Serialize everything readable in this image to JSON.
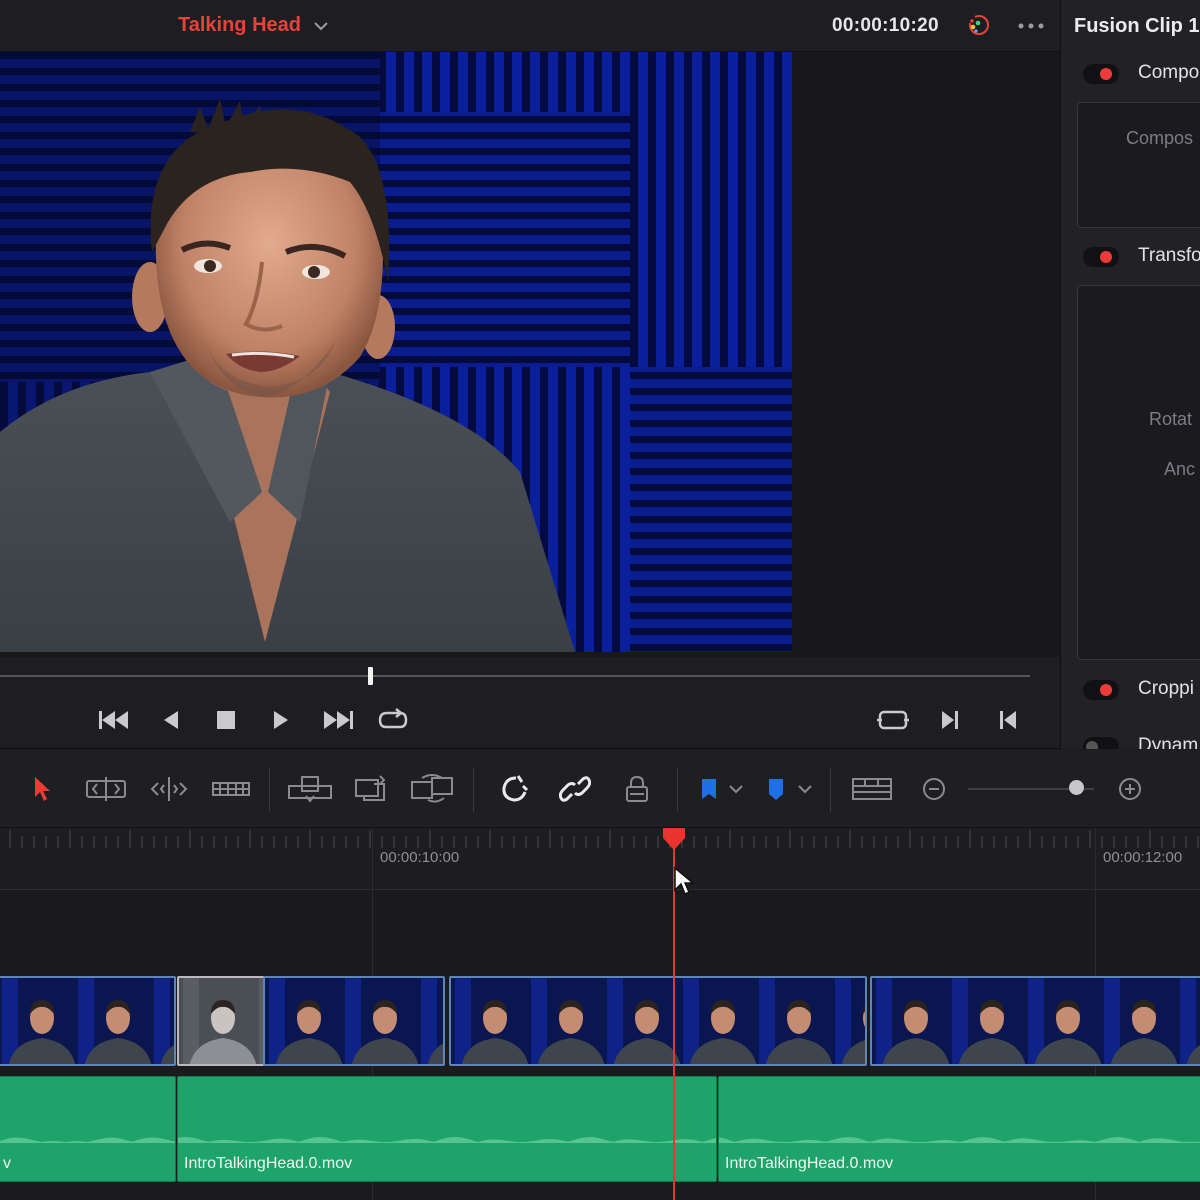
{
  "header": {
    "timeline_name": "Talking Head",
    "timecode": "00:00:10:20"
  },
  "inspector": {
    "title": "Fusion Clip 1",
    "sections": [
      {
        "label": "Compo"
      },
      {
        "label": "Transfo"
      },
      {
        "label": "Croppi"
      },
      {
        "label": "Dynam"
      }
    ],
    "fields": {
      "composite": "Compos",
      "rotation": "Rotat",
      "anchor": "Anc"
    }
  },
  "timeline": {
    "ruler_labels": [
      "00:00:10:00",
      "00:00:12:00"
    ],
    "audio_clips": [
      {
        "name": "v"
      },
      {
        "name": "IntroTalkingHead.0.mov"
      },
      {
        "name": "IntroTalkingHead.0.mov"
      }
    ]
  },
  "colors": {
    "accent_red": "#e8413a",
    "audio_green": "#1ea46a",
    "video_clip_border": "#5e86b5",
    "flag_blue": "#1f6fe6"
  },
  "icons": {
    "transport": [
      "skip-to-start-icon",
      "play-reverse-icon",
      "stop-icon",
      "play-icon",
      "skip-to-end-icon",
      "loop-icon",
      "match-frame-icon",
      "next-edit-icon",
      "previous-edit-icon"
    ],
    "toolbar": [
      "selection-arrow-icon",
      "trim-edit-icon",
      "dynamic-trim-icon",
      "blade-icon",
      "insert-clip-icon",
      "overwrite-clip-icon",
      "replace-clip-icon",
      "snapping-icon",
      "linked-selection-icon",
      "position-lock-icon",
      "flag-icon",
      "marker-icon",
      "timeline-view-options-icon",
      "zoom-out-icon",
      "zoom-in-icon"
    ]
  }
}
